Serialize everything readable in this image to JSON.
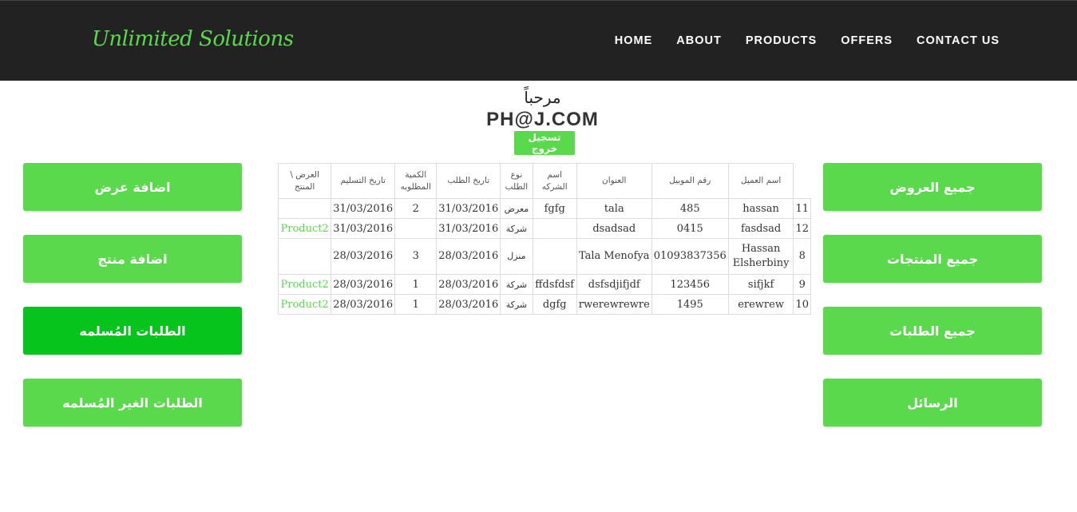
{
  "navbar": {
    "brand": "Unlimited Solutions",
    "links": [
      "HOME",
      "ABOUT",
      "PRODUCTS",
      "OFFERS",
      "CONTACT US"
    ]
  },
  "welcome": {
    "greeting": "مرحباً",
    "user": "PH@J.COM",
    "logout_label": "تسجيل خروج"
  },
  "left_menu": [
    {
      "label": "اضافة عرض"
    },
    {
      "label": "اضافة منتج"
    },
    {
      "label": "الطلبات المُسلمه"
    },
    {
      "label": "الطلبات الغير المُسلمه"
    }
  ],
  "right_menu": [
    {
      "label": "جميع العروض"
    },
    {
      "label": "جميع المنتجات"
    },
    {
      "label": "جميع الطلبات"
    },
    {
      "label": "الرسائل"
    }
  ],
  "table": {
    "headers": {
      "offer_product": "العرض \\ المنتج",
      "delivery_date": "تاريخ التسليم",
      "quantity": "الكمية المطلوبه",
      "order_date": "تاريخ الطلب",
      "order_type": "نوع الطلب",
      "company": "اسم الشركه",
      "address": "العنوان",
      "mobile": "رقم الموبيل",
      "client": "اسم العميل"
    },
    "rows": [
      {
        "offer_product": "",
        "delivery_date": "31/03/2016",
        "quantity": "2",
        "order_date": "31/03/2016",
        "order_type": "معرض",
        "company": "fgfg",
        "address": "tala",
        "mobile": "485",
        "client": "hassan",
        "id": "11"
      },
      {
        "offer_product": "Product2",
        "delivery_date": "31/03/2016",
        "quantity": "",
        "order_date": "31/03/2016",
        "order_type": "شركة",
        "company": "",
        "address": "dsadsad",
        "mobile": "0415",
        "client": "fasdsad",
        "id": "12"
      },
      {
        "offer_product": "",
        "delivery_date": "28/03/2016",
        "quantity": "3",
        "order_date": "28/03/2016",
        "order_type": "منزل",
        "company": "",
        "address": "Tala Menofya",
        "mobile": "01093837356",
        "client": "Hassan Elsherbiny",
        "id": "8"
      },
      {
        "offer_product": "Product2",
        "delivery_date": "28/03/2016",
        "quantity": "1",
        "order_date": "28/03/2016",
        "order_type": "شركة",
        "company": "ffdsfdsf",
        "address": "dsfsdjifjdf",
        "mobile": "123456",
        "client": "sifjkf",
        "id": "9"
      },
      {
        "offer_product": "Product2",
        "delivery_date": "28/03/2016",
        "quantity": "1",
        "order_date": "28/03/2016",
        "order_type": "شركة",
        "company": "dgfg",
        "address": "rwerewrewre",
        "mobile": "1495",
        "client": "erewrew",
        "id": "10"
      }
    ]
  },
  "colors": {
    "navbar_bg": "#222222",
    "accent": "#5bd94c",
    "active_button": "#06c41c"
  }
}
